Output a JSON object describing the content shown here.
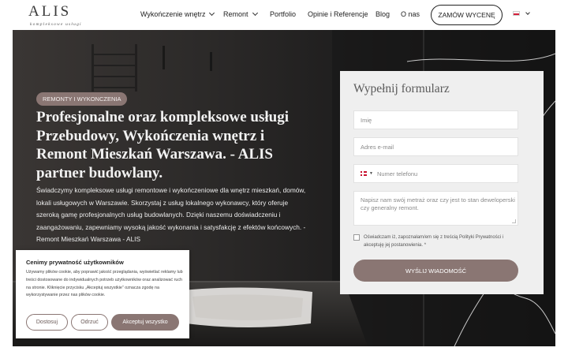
{
  "brand": {
    "logo": "ALIS",
    "tagline": "kompleksowe usługi"
  },
  "nav": {
    "items": [
      {
        "label": "Wykończenie wnętrz",
        "has_dropdown": true
      },
      {
        "label": "Remont",
        "has_dropdown": true
      },
      {
        "label": "Portfolio",
        "has_dropdown": false
      },
      {
        "label": "Opinie i Referencje",
        "has_dropdown": false
      },
      {
        "label": "Blog",
        "has_dropdown": false
      },
      {
        "label": "O nas",
        "has_dropdown": false
      }
    ],
    "cta_label": "ZAMÓW WYCENĘ",
    "language_icon": "poland-flag-icon"
  },
  "hero": {
    "badge": "REMONTY I WYKONCZENIA",
    "title": "Profesjonalne oraz kompleksowe usługi Przebudowy, Wykończenia wnętrz i Remont Mieszkań Warszawa. - ALIS partner budowlany.",
    "description": "Świadczymy kompleksowe usługi remontowe i wykończeniowe dla wnętrz mieszkań, domów, lokali usługowych w Warszawie. Skorzystaj z usług lokalnego wykonawcy, który oferuje szeroką gamę profesjonalnych usług budowlanych. Dzięki naszemu doświadczeniu i zaangażowaniu, zapewniamy wysoką jakość wykonania i satysfakcję z efektów końcowych. - Remont Mieszkań Warszawa - ALIS"
  },
  "form": {
    "title": "Wypełnij formularz",
    "name_placeholder": "Imię",
    "email_placeholder": "Adres e-mail",
    "phone_placeholder": "Numer telefonu",
    "message_placeholder": "Napisz nam swój metraż oraz czy jest to stan deweloperski czy generalny remont.",
    "consent_text": "Oświadczam iż, zapoznałam/em się z treścią Polityki Prywatności i akceptuję jej postanowienia. *",
    "submit_label": "WYŚLIJ WIADOMOŚĆ"
  },
  "cookie": {
    "title": "Cenimy prywatność użytkowników",
    "text": "Używamy plików cookie, aby poprawić jakość przeglądania, wyświetlać reklamy lub treści dostosowane do indywidualnych potrzeb użytkowników oraz analizować ruch na stronie. Kliknięcie przycisku „Akceptuj wszystkie” oznacza zgodę na wykorzystywanie przez nas plików cookie.",
    "customize_label": "Dostosuj",
    "reject_label": "Odrzuć",
    "accept_label": "Akceptuj wszystko"
  },
  "colors": {
    "accent": "#8a7673",
    "hero_dark": "#1c1c1c",
    "form_bg": "#efefef"
  }
}
